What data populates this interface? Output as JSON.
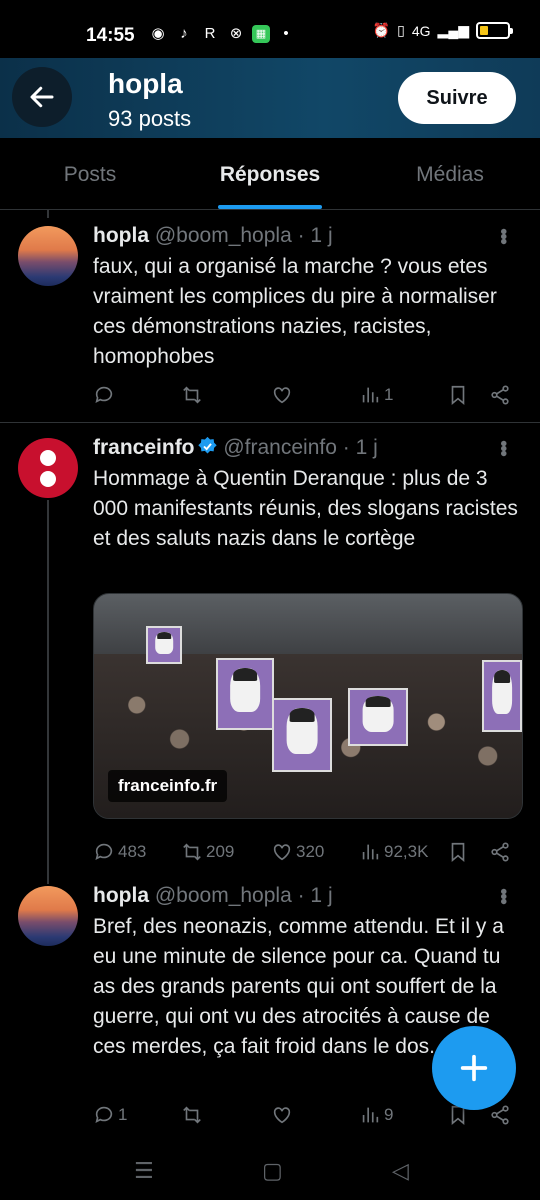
{
  "status_bar": {
    "time": "14:55",
    "app_icons": [
      "discord-icon",
      "tiktok-icon",
      "r-icon",
      "xbox-icon",
      "green-app-icon"
    ],
    "network": "4G",
    "battery_level": 0.25
  },
  "header": {
    "display_name": "hopla",
    "post_count": "93 posts",
    "follow_label": "Suivre"
  },
  "tabs": [
    {
      "label": "Posts",
      "active": false
    },
    {
      "label": "Réponses",
      "active": true
    },
    {
      "label": "Médias",
      "active": false
    }
  ],
  "posts": [
    {
      "display_name": "hopla",
      "handle": "@boom_hopla",
      "time": "· 1 j",
      "text": "faux, qui a organisé la marche ? vous etes vraiment les complices du pire à normaliser ces démonstrations nazies, racistes, homophobes",
      "replies": "",
      "reposts": "",
      "likes": "",
      "views": "1"
    },
    {
      "display_name": "franceinfo",
      "handle": "@franceinfo",
      "time": "· 1 j",
      "verified": true,
      "text": "Hommage à Quentin Deranque : plus de 3 000 manifestants réunis, des slogans racistes et des saluts nazis dans le cortège",
      "media_source": "franceinfo.fr",
      "replies": "483",
      "reposts": "209",
      "likes": "320",
      "views": "92,3K"
    },
    {
      "display_name": "hopla",
      "handle": "@boom_hopla",
      "time": "· 1 j",
      "text": "Bref, des neonazis, comme attendu. Et il y a eu une minute de silence pour ca. Quand tu as des grands parents qui ont souffert de la guerre, qui ont vu des atrocités à cause de ces merdes, ça fait froid dans le dos.",
      "replies": "1",
      "reposts": "",
      "likes": "",
      "views": "9"
    }
  ],
  "colors": {
    "accent": "#1d9bf0",
    "header_bg": "#114767",
    "franceinfo_red": "#c8102e"
  }
}
